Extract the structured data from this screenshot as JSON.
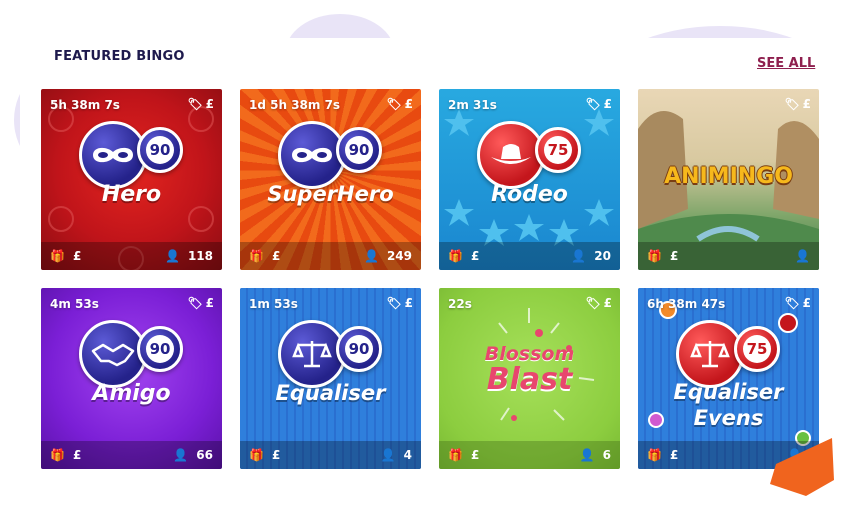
{
  "section": {
    "title": "FEATURED BINGO",
    "see_all": "SEE ALL"
  },
  "currency": "£",
  "cards": [
    {
      "timer": "5h 38m 7s",
      "name": "Hero",
      "ball_number": "90",
      "players": "118",
      "icon": "mask-icon",
      "theme": "red"
    },
    {
      "timer": "1d 5h 38m 7s",
      "name": "SuperHero",
      "ball_number": "90",
      "players": "249",
      "icon": "mask-icon",
      "theme": "orange"
    },
    {
      "timer": "2m 31s",
      "name": "Rodeo",
      "ball_number": "75",
      "players": "20",
      "icon": "cowboy-hat-icon",
      "theme": "blue-stars"
    },
    {
      "timer": "",
      "name": "ANIMINGO",
      "ball_number": "",
      "players": "",
      "icon": "",
      "theme": "landscape"
    },
    {
      "timer": "4m 53s",
      "name": "Amigo",
      "ball_number": "90",
      "players": "66",
      "icon": "handshake-icon",
      "theme": "purple"
    },
    {
      "timer": "1m 53s",
      "name": "Equaliser",
      "ball_number": "90",
      "players": "4",
      "icon": "scales-icon",
      "theme": "blue-grid"
    },
    {
      "timer": "22s",
      "name_line1": "Blossom",
      "name_line2": "Blast",
      "players": "6",
      "theme": "green"
    },
    {
      "timer": "6h 38m 47s",
      "name_line1": "Equaliser",
      "name_line2": "Evens",
      "ball_number": "75",
      "players": "",
      "icon": "scales-icon",
      "theme": "blue-grid"
    }
  ],
  "colors": {
    "heading": "#1e1a4d",
    "link": "#8e1f4e",
    "ball_blue": "#24228a",
    "ball_red": "#c4161c",
    "accent_orange": "#f0641e"
  }
}
